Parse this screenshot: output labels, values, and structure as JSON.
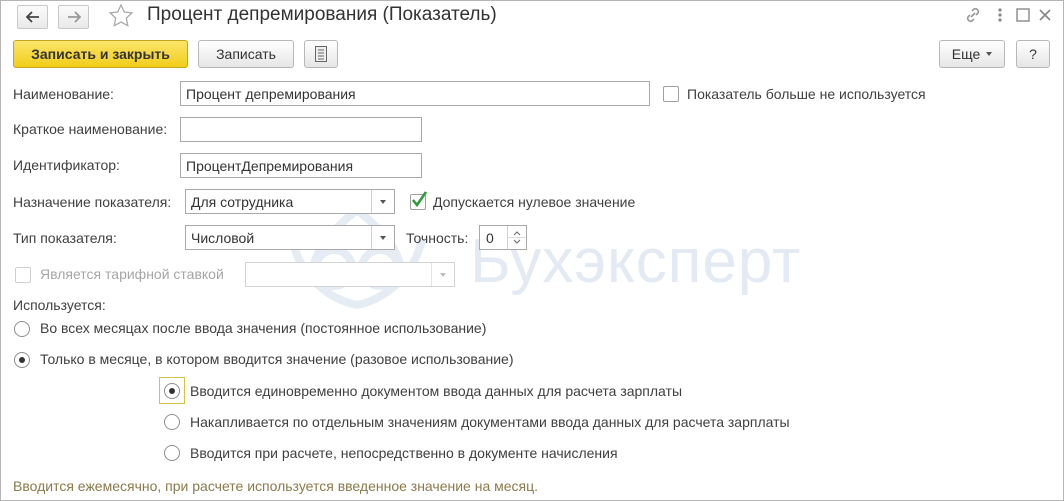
{
  "window": {
    "title": "Процент депремирования (Показатель)",
    "nav_back_icon": "arrow-left-icon",
    "nav_forward_icon": "arrow-right-icon",
    "favorite_icon": "star-icon",
    "link_icon": "link-icon",
    "menu_icon": "more-vertical-icon",
    "maximize_icon": "maximize-icon",
    "close_icon": "close-icon"
  },
  "toolbar": {
    "save_close_label": "Записать и закрыть",
    "save_label": "Записать",
    "doc_icon": "document-list-icon",
    "more_label": "Еще",
    "help_label": "?"
  },
  "form": {
    "name_label": "Наименование:",
    "name_value": "Процент депремирования",
    "unused_label": "Показатель больше не используется",
    "short_name_label": "Краткое наименование:",
    "short_name_value": "",
    "id_label": "Идентификатор:",
    "id_value": "ПроцентДепремирования",
    "purpose_label": "Назначение показателя:",
    "purpose_value": "Для сотрудника",
    "zero_allowed_label": "Допускается нулевое значение",
    "zero_allowed_checked": true,
    "type_label": "Тип показателя:",
    "type_value": "Числовой",
    "precision_label": "Точность:",
    "precision_value": "0",
    "tariff_label": "Является тарифной ставкой",
    "tariff_value": "",
    "used_label": "Используется:",
    "usage_options": [
      "Во всех месяцах после ввода значения (постоянное использование)",
      "Только в месяце, в котором вводится значение (разовое использование)"
    ],
    "usage_selected": 1,
    "input_options": [
      "Вводится единовременно документом ввода данных для расчета зарплаты",
      "Накапливается по отдельным значениям документами ввода данных для расчета зарплаты",
      "Вводится при расчете, непосредственно в документе начисления"
    ],
    "input_selected": 0,
    "hint": "Вводится ежемесячно, при расчете используется введенное значение на месяц."
  },
  "watermark_text": "Бухэксперт",
  "colors": {
    "primary_button": "#f4d31f",
    "checkmark": "#2e9c3a",
    "hint_text": "#8a7a4a",
    "watermark": "#e3eaf3"
  }
}
